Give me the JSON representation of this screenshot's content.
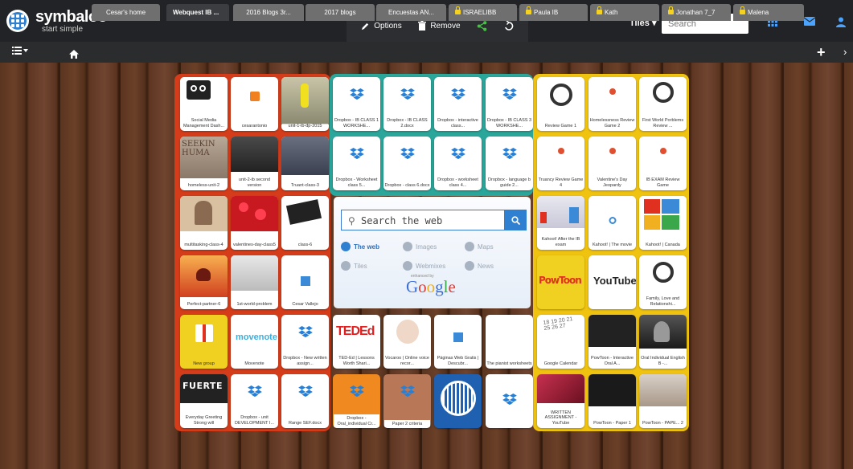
{
  "app": {
    "name": "symbaloo",
    "tagline": "start simple"
  },
  "toolbar": {
    "options": "Options",
    "remove": "Remove"
  },
  "header": {
    "tiles_label": "Tiles",
    "search_placeholder": "Search"
  },
  "tabs": [
    "Cesar's home",
    "Webquest IB ...",
    "2016 Blogs 3r...",
    "2017 blogs",
    "Encuestas AN...",
    "ISRAELIBB",
    "Paula IB",
    "Kath",
    "Jonathan 7_7",
    "Malena"
  ],
  "red_tiles": [
    "Social Media Management Dash...",
    "cesarantonio",
    "unit-1-ib-dp-2015",
    "homeless-unit-2",
    "unit-2-ib second version",
    "Truant-class-3",
    "multitasking-class-4",
    "valentines-day-class5",
    "class-6",
    "Perfect-partner-6",
    "1st-world-problem",
    "Cesar Vallejo",
    "New group",
    "Movenote",
    "Dropbox - New written assign...",
    "Everyday Greeting Strong will",
    "Dropbox - unit DEVELOPMENT I...",
    "Range SEF.docx"
  ],
  "teal_tiles": [
    "Dropbox - IB CLASS 1 WORKSHE...",
    "Dropbox - IB CLASS 2.docx",
    "Dropbox - interactive class...",
    "Dropbox - IB CLASS 3 WORKSHE...",
    "Dropbox - Worksheet class 5...",
    "Dropbox - class 6.docx",
    "Dropbox - worksheet class 4...",
    "Dropbox - language b guide 2..."
  ],
  "bottom_tiles": [
    "TED-Ed | Lessons Worth Shari...",
    "Vocaroo | Online voice recor...",
    "Páginas Web Gratis | Descubr...",
    "The pianist worksheets",
    "Dropbox - Oral_individual Cr...",
    "Paper 2 criteria",
    "",
    ""
  ],
  "yellow_tiles": [
    "Review Game 1",
    "Homelessness Review Game 2",
    "First World Porblems Review ...",
    "",
    "Truancy Review Game 4",
    "Valentine's Day Jeopardy",
    "IB EXAM Review Game",
    "Kahoot! After the IB exam",
    "Kahoot! | The movie",
    "Kahoot! | Canada",
    "",
    "",
    "Family, Love and Relationshi...",
    "Google Calendar",
    "PowToon - Interactive Oral A...",
    "Oral Individual English B -...",
    "WRITTEN ASSIGNMENT - YouTube",
    "PowToon - Paper 1",
    "PowToon - PAPE... 2"
  ],
  "tile_marks": {
    "ted": "TEDEd",
    "movenote": "movenote",
    "youtube": "YouTube",
    "fuerte": "FUERTE",
    "powtoon": "PowToon",
    "calendar": "18 19 20 21 25 26 27"
  },
  "search_widget": {
    "placeholder": "Search the web",
    "options": [
      "The web",
      "Images",
      "Maps",
      "Tiles",
      "Webmixes",
      "News"
    ],
    "enhanced_by": "enhanced by",
    "brand": "Google"
  },
  "colors": {
    "red_group": "#d53c1a",
    "teal_group": "#2aa69a",
    "yellow_group": "#f0c310",
    "accent": "#2f80d1"
  }
}
